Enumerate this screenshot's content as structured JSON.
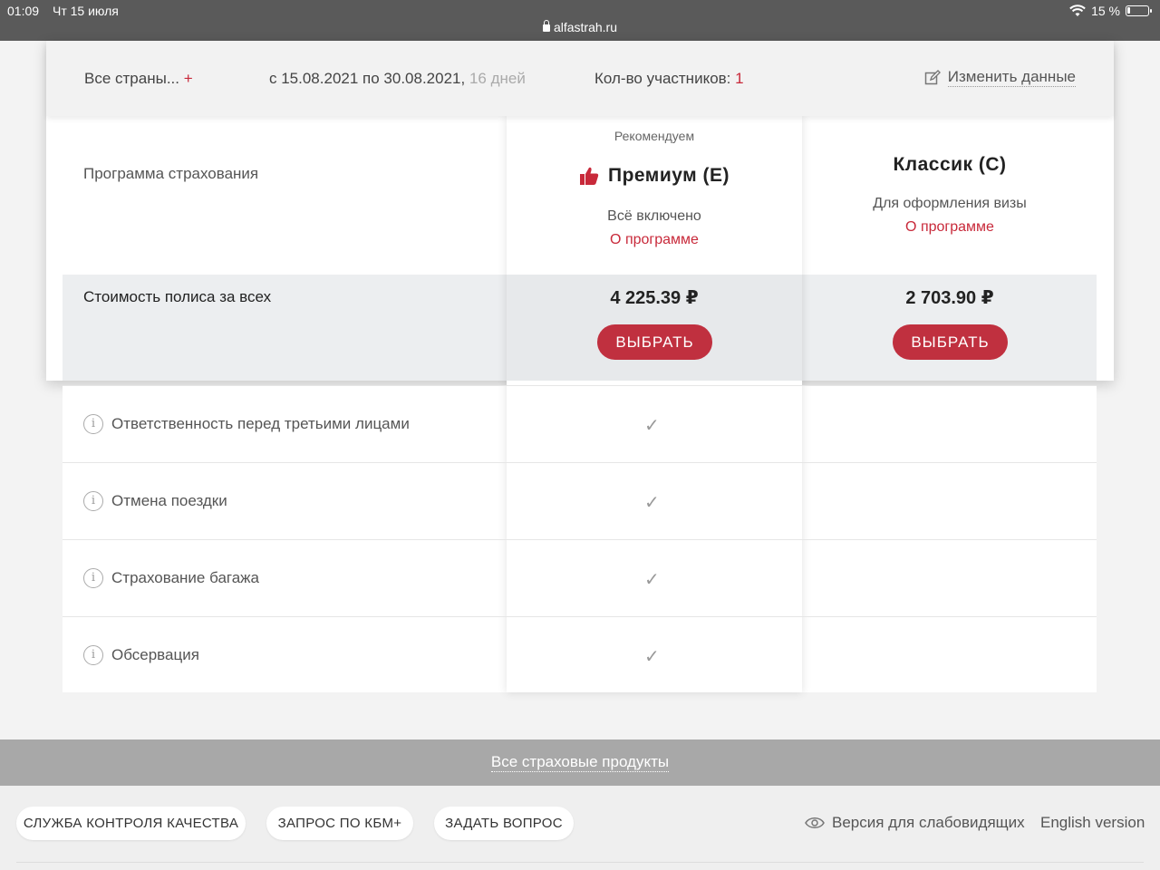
{
  "status_bar": {
    "time": "01:09",
    "date": "Чт 15 июля",
    "battery": "15 %",
    "url": "alfastrah.ru",
    "battery_level_percent": 15
  },
  "summary": {
    "countries": "Все страны...",
    "countries_plus": "+",
    "dates": "с 15.08.2021 по 30.08.2021,",
    "days": "16 дней",
    "participants_label": "Кол-во участников:",
    "participants_count": "1",
    "edit_label": "Изменить данные"
  },
  "table": {
    "program_label": "Программа страхования",
    "cost_label": "Стоимость полиса за всех",
    "plans": [
      {
        "recommended": "Рекомендуем",
        "name": "Премиум (E)",
        "description": "Всё включено",
        "about": "О программе",
        "price": "4 225.39 ₽",
        "button": "ВЫБРАТЬ"
      },
      {
        "recommended": "",
        "name": "Классик (C)",
        "description": "Для оформления визы",
        "about": "О программе",
        "price": "2 703.90 ₽",
        "button": "ВЫБРАТЬ"
      }
    ],
    "features": [
      {
        "label": "Ответственность перед третьими лицами",
        "premium": "✓",
        "classic": ""
      },
      {
        "label": "Отмена поездки",
        "premium": "✓",
        "classic": ""
      },
      {
        "label": "Страхование багажа",
        "premium": "✓",
        "classic": ""
      },
      {
        "label": "Обсервация",
        "premium": "✓",
        "classic": ""
      }
    ]
  },
  "footer": {
    "all_products": "Все страховые продукты",
    "buttons": [
      "СЛУЖБА КОНТРОЛЯ КАЧЕСТВА",
      "ЗАПРОС ПО КБМ+",
      "ЗАДАТЬ ВОПРОС"
    ],
    "accessibility": "Версия для слабовидящих",
    "english": "English version"
  },
  "colors": {
    "accent": "#c8293a",
    "button": "#c0303f",
    "status_bar": "#5a5a5a",
    "footer_band": "#a8a8a8"
  }
}
